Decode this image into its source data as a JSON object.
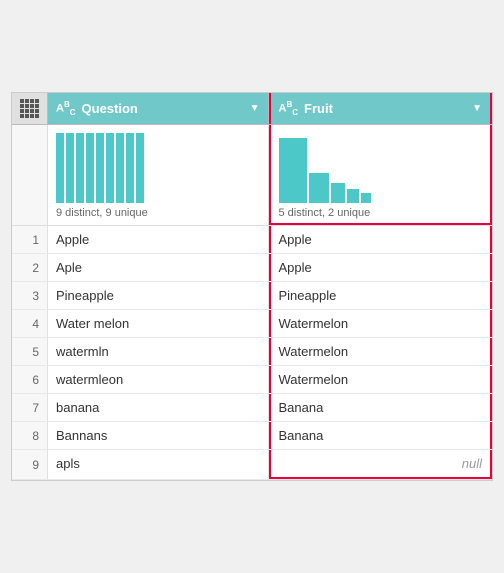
{
  "columns": {
    "rownum_icon": "grid",
    "question": {
      "label": "Question",
      "type_icon": "A_C",
      "histogram_label": "9 distinct, 9 unique",
      "bars": [
        70,
        70,
        70,
        70,
        70,
        70,
        70,
        70,
        70
      ]
    },
    "fruit": {
      "label": "Fruit",
      "type_icon": "A_C",
      "histogram_label": "5 distinct, 2 unique",
      "bars": [
        60,
        30,
        20,
        15,
        10
      ]
    }
  },
  "rows": [
    {
      "num": "1",
      "question": "Apple",
      "fruit": "Apple",
      "null": false
    },
    {
      "num": "2",
      "question": "Aple",
      "fruit": "Apple",
      "null": false
    },
    {
      "num": "3",
      "question": "Pineapple",
      "fruit": "Pineapple",
      "null": false
    },
    {
      "num": "4",
      "question": "Water melon",
      "fruit": "Watermelon",
      "null": false
    },
    {
      "num": "5",
      "question": "watermln",
      "fruit": "Watermelon",
      "null": false
    },
    {
      "num": "6",
      "question": "watermleon",
      "fruit": "Watermelon",
      "null": false
    },
    {
      "num": "7",
      "question": "banana",
      "fruit": "Banana",
      "null": false
    },
    {
      "num": "8",
      "question": "Bannans",
      "fruit": "Banana",
      "null": false
    },
    {
      "num": "9",
      "question": "apls",
      "fruit": "",
      "null": true
    }
  ]
}
